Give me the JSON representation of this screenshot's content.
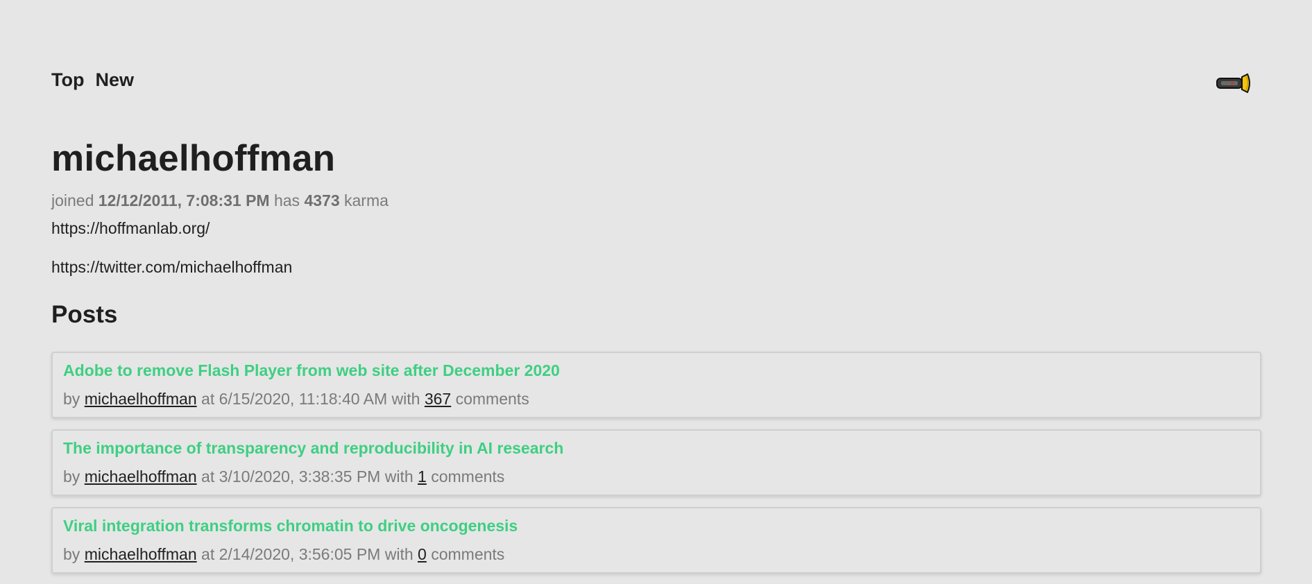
{
  "nav": {
    "top_label": "Top",
    "new_label": "New",
    "theme_toggle_icon": "flashlight-icon"
  },
  "profile": {
    "username": "michaelhoffman",
    "joined_prefix": "joined",
    "joined_date": "12/12/2011, 7:08:31 PM",
    "has_label": "has",
    "karma": "4373",
    "karma_label": "karma",
    "about_lines": [
      "https://hoffmanlab.org/",
      "https://twitter.com/michaelhoffman"
    ]
  },
  "posts_section": {
    "title": "Posts",
    "by_label": "by",
    "at_label": "at",
    "with_label": "with",
    "comments_label": "comments",
    "items": [
      {
        "title": "Adobe to remove Flash Player from web site after December 2020",
        "author": "michaelhoffman",
        "time": "6/15/2020, 11:18:40 AM",
        "comments": "367"
      },
      {
        "title": "The importance of transparency and reproducibility in AI research",
        "author": "michaelhoffman",
        "time": "3/10/2020, 3:38:35 PM",
        "comments": "1"
      },
      {
        "title": "Viral integration transforms chromatin to drive oncogenesis",
        "author": "michaelhoffman",
        "time": "2/14/2020, 3:56:05 PM",
        "comments": "0"
      }
    ]
  },
  "colors": {
    "background": "#e6e6e6",
    "post_title": "#3ecf82",
    "muted_text": "#7a7a7a",
    "primary_text": "#1f1f1f"
  }
}
